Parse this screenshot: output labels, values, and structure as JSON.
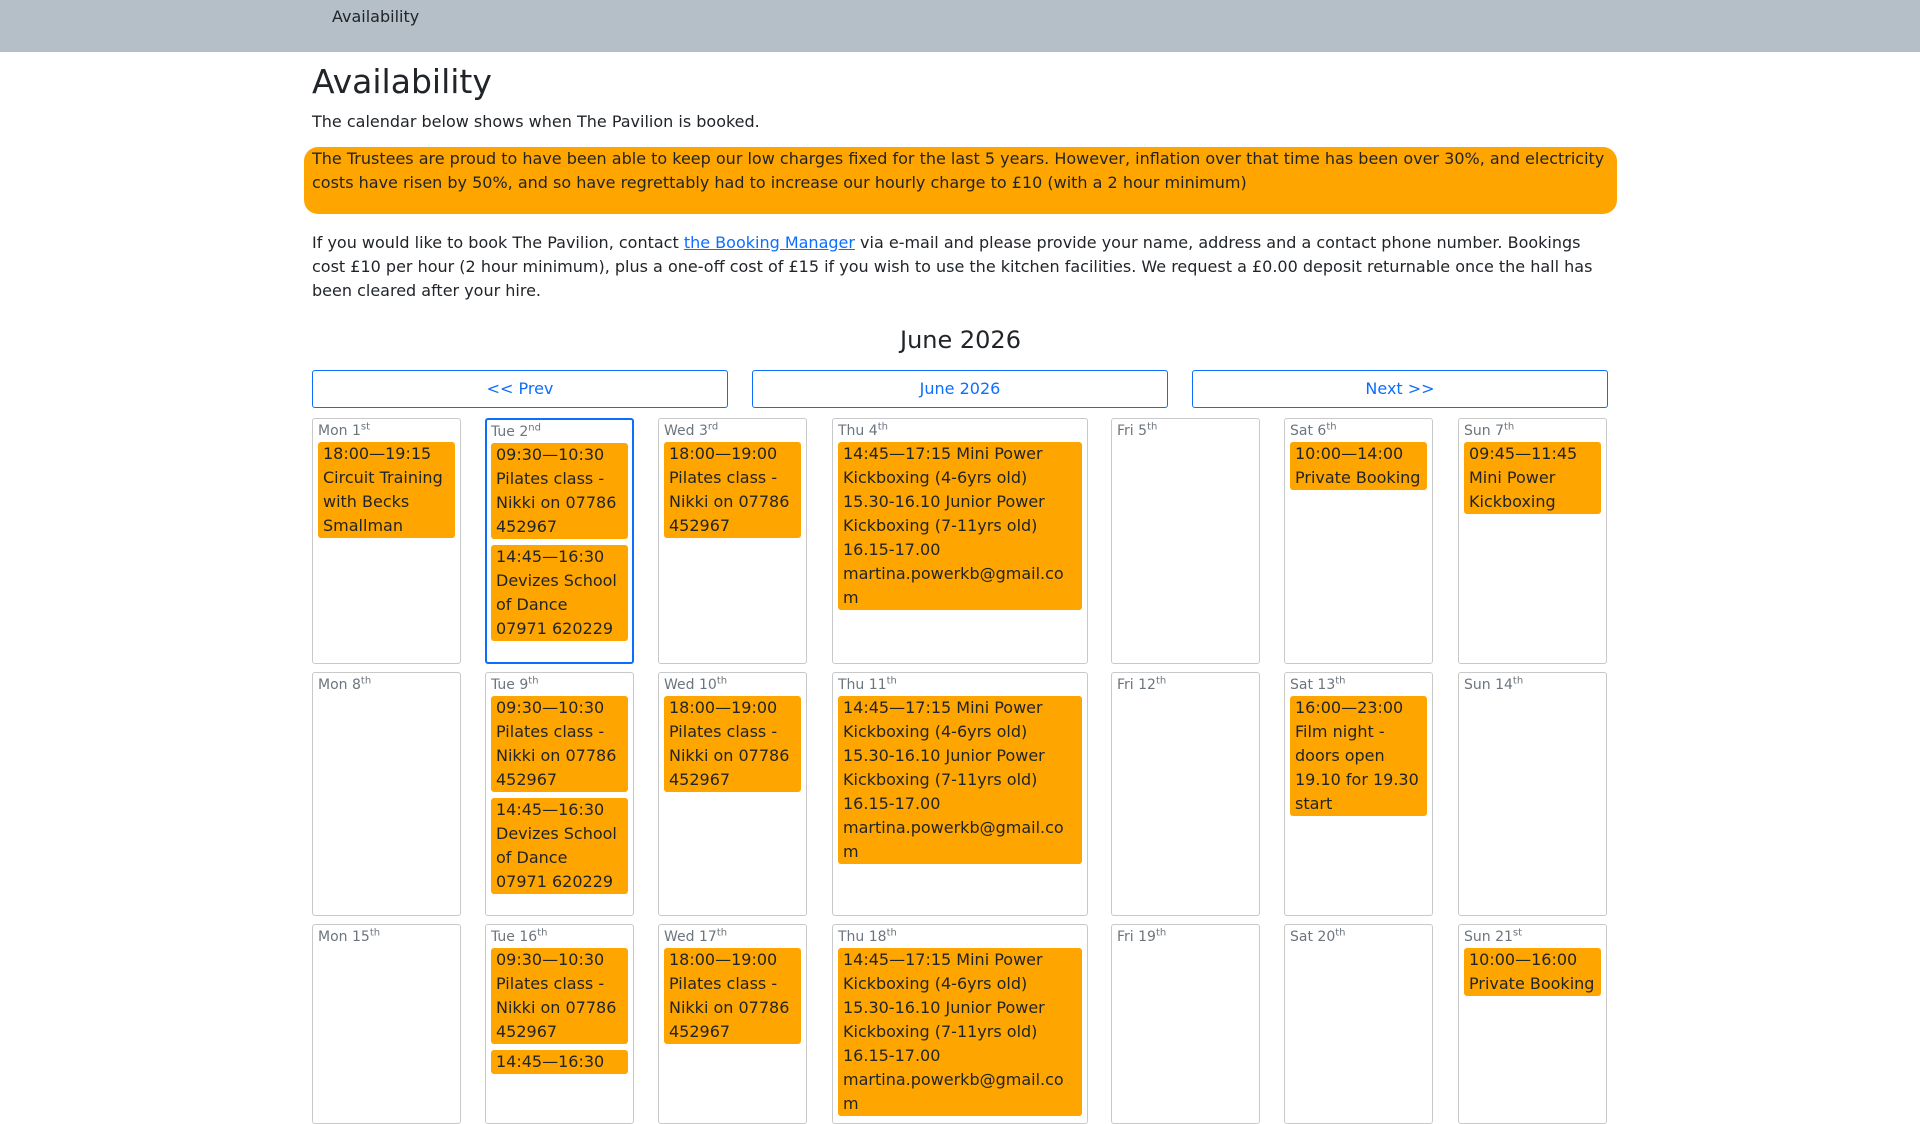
{
  "nav": {
    "item": "Availability"
  },
  "page": {
    "title": "Availability",
    "intro": "The calendar below shows when The Pavilion is booked.",
    "notice": "The Trustees are proud to have been able to keep our low charges fixed for the last 5 years. However, inflation over that time has been over 30%, and electricity costs have risen by 50%, and so have regrettably had to increase our hourly charge to £10 (with a 2 hour minimum)",
    "booking_prefix": "If you would like to book The Pavilion, contact ",
    "booking_link": "the Booking Manager",
    "booking_suffix": " via e-mail and please provide your name, address and a contact phone number. Bookings cost £10 per hour (2 hour minimum), plus a one-off cost of £15 if you wish to use the kitchen facilities. We request a £0.00 deposit returnable once the hall has been cleared after your hire."
  },
  "calendar": {
    "month_title": "June 2026",
    "prev_label": "<< Prev",
    "current_label": "June 2026",
    "next_label": "Next >>",
    "weeks": [
      [
        {
          "dow": "Mon",
          "num": "1",
          "suffix": "st",
          "events": [
            "18:00—19:15\n Circuit Training with Becks Smallman"
          ]
        },
        {
          "dow": "Tue",
          "num": "2",
          "suffix": "nd",
          "today": true,
          "events": [
            "09:30—10:30\n Pilates class - Nikki on 07786 452967",
            "14:45—16:30\n Devizes School of Dance\n07971 620229"
          ]
        },
        {
          "dow": "Wed",
          "num": "3",
          "suffix": "rd",
          "events": [
            "18:00—19:00\n Pilates class - Nikki on 07786 452967"
          ]
        },
        {
          "dow": "Thu",
          "num": "4",
          "suffix": "th",
          "events": [
            "14:45—17:15  Mini Power Kickboxing (4-6yrs old) 15.30-16.10 Junior Power Kickboxing (7-11yrs old) 16.15-17.00 martina.powerkb@gmail.com"
          ]
        },
        {
          "dow": "Fri",
          "num": "5",
          "suffix": "th",
          "events": []
        },
        {
          "dow": "Sat",
          "num": "6",
          "suffix": "th",
          "events": [
            "10:00—14:00\n Private Booking"
          ]
        },
        {
          "dow": "Sun",
          "num": "7",
          "suffix": "th",
          "events": [
            "09:45—11:45\n Mini Power Kickboxing"
          ]
        }
      ],
      [
        {
          "dow": "Mon",
          "num": "8",
          "suffix": "th",
          "events": []
        },
        {
          "dow": "Tue",
          "num": "9",
          "suffix": "th",
          "events": [
            "09:30—10:30\n Pilates class - Nikki on 07786 452967",
            "14:45—16:30\n Devizes School of Dance 07971 620229"
          ]
        },
        {
          "dow": "Wed",
          "num": "10",
          "suffix": "th",
          "events": [
            "18:00—19:00\n Pilates class - Nikki on 07786 452967"
          ]
        },
        {
          "dow": "Thu",
          "num": "11",
          "suffix": "th",
          "events": [
            "14:45—17:15  Mini Power Kickboxing (4-6yrs old) 15.30-16.10 Junior Power Kickboxing (7-11yrs old) 16.15-17.00 martina.powerkb@gmail.com"
          ]
        },
        {
          "dow": "Fri",
          "num": "12",
          "suffix": "th",
          "events": []
        },
        {
          "dow": "Sat",
          "num": "13",
          "suffix": "th",
          "events": [
            "16:00—23:00\n Film night - doors open 19.10 for 19.30 start"
          ]
        },
        {
          "dow": "Sun",
          "num": "14",
          "suffix": "th",
          "events": []
        }
      ],
      [
        {
          "dow": "Mon",
          "num": "15",
          "suffix": "th",
          "events": []
        },
        {
          "dow": "Tue",
          "num": "16",
          "suffix": "th",
          "events": [
            "09:30—10:30\n Pilates class - Nikki on 07786 452967",
            "14:45—16:30"
          ]
        },
        {
          "dow": "Wed",
          "num": "17",
          "suffix": "th",
          "events": [
            "18:00—19:00\n Pilates class - Nikki on 07786 452967"
          ]
        },
        {
          "dow": "Thu",
          "num": "18",
          "suffix": "th",
          "events": [
            "14:45—17:15  Mini Power Kickboxing (4-6yrs old) 15.30-16.10 Junior Power Kickboxing (7-11yrs old) 16.15-17.00 martina.powerkb@gmail.com"
          ]
        },
        {
          "dow": "Fri",
          "num": "19",
          "suffix": "th",
          "events": []
        },
        {
          "dow": "Sat",
          "num": "20",
          "suffix": "th",
          "events": []
        },
        {
          "dow": "Sun",
          "num": "21",
          "suffix": "st",
          "events": [
            "10:00—16:00\n Private Booking"
          ]
        }
      ]
    ]
  }
}
